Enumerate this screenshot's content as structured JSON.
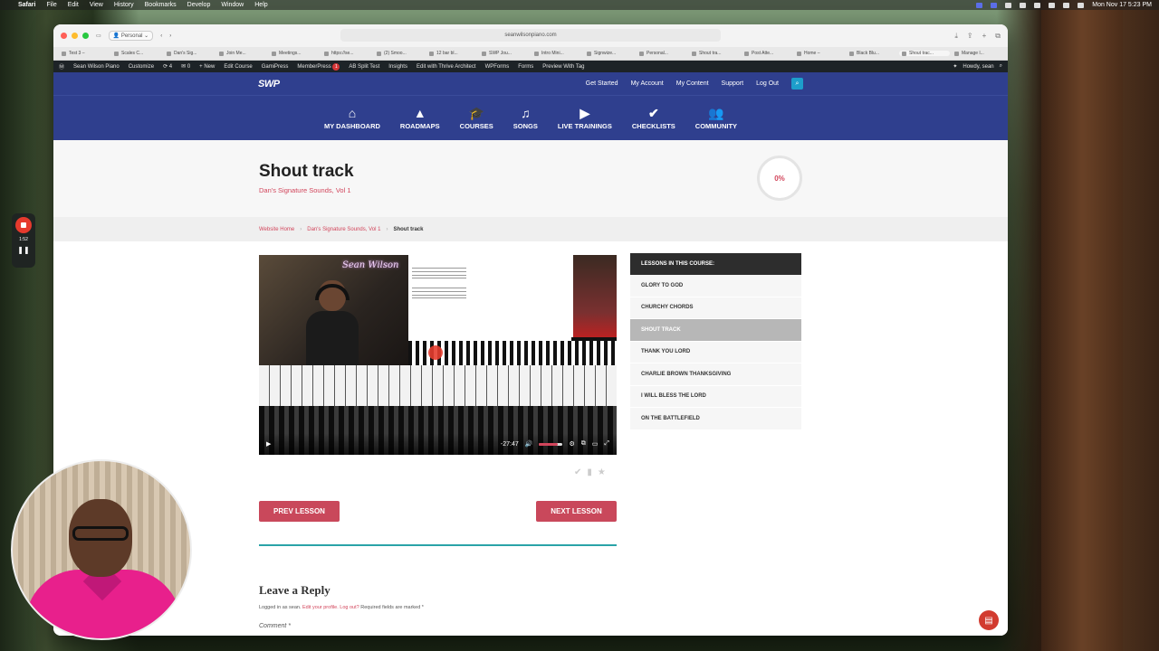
{
  "menubar": {
    "app": "Safari",
    "items": [
      "File",
      "Edit",
      "View",
      "History",
      "Bookmarks",
      "Develop",
      "Window",
      "Help"
    ],
    "clock": "Mon Nov 17  5:23 PM"
  },
  "browser": {
    "profile": "Personal",
    "url": "seanwilsonpiano.com",
    "tabs": [
      "Test 3 –",
      "Scales C...",
      "Dan's Sig...",
      "Join Me...",
      "Meetings...",
      "https://se...",
      "(2) Smoo...",
      "12 bar bl...",
      "SWP Jou...",
      "Intro Mini...",
      "Signwize...",
      "Personal...",
      "Shout tra...",
      "Post Atte...",
      "Home –",
      "Black Blu...",
      "Shout trac...",
      "Manage l..."
    ]
  },
  "adminbar": {
    "site": "Sean Wilson Piano",
    "customize": "Customize",
    "updates": "4",
    "comments": "0",
    "new": "New",
    "edit_course": "Edit Course",
    "gamipress": "GamiPress",
    "memberpress": "MemberPress",
    "memberpress_badge": "1",
    "ab_split": "AB Split Test",
    "insights": "Insights",
    "thrive": "Edit with Thrive Architect",
    "wpforms": "WPForms",
    "forms": "Forms",
    "preview_tag": "Preview With Tag",
    "howdy": "Howdy, sean"
  },
  "site": {
    "logo": "SWP",
    "toplinks": [
      "Get Started",
      "My Account",
      "My Content",
      "Support",
      "Log Out"
    ],
    "nav": [
      {
        "label": "MY DASHBOARD",
        "icon": "home-icon",
        "glyph": "⌂"
      },
      {
        "label": "ROADMAPS",
        "icon": "roadmap-icon",
        "glyph": "▲"
      },
      {
        "label": "COURSES",
        "icon": "graduation-cap-icon",
        "glyph": "🎓"
      },
      {
        "label": "SONGS",
        "icon": "music-note-icon",
        "glyph": "♫"
      },
      {
        "label": "LIVE TRAININGS",
        "icon": "play-icon",
        "glyph": "▶"
      },
      {
        "label": "CHECKLISTS",
        "icon": "checkmark-icon",
        "glyph": "✔"
      },
      {
        "label": "COMMUNITY",
        "icon": "users-icon",
        "glyph": "👥"
      }
    ]
  },
  "page": {
    "title": "Shout track",
    "subtitle": "Dan's Signature Sounds, Vol 1",
    "progress": "0%",
    "breadcrumb": [
      "Website Home",
      "Dan's Signature Sounds, Vol 1",
      "Shout track"
    ]
  },
  "video": {
    "neon_sign": "Sean Wilson",
    "time_remaining": "-27:47",
    "volume_level": 0.8
  },
  "lesson_nav": {
    "prev": "PREV LESSON",
    "next": "NEXT LESSON"
  },
  "sidebar": {
    "header": "LESSONS IN THIS COURSE:",
    "lessons": [
      "GLORY TO GOD",
      "CHURCHY CHORDS",
      "SHOUT TRACK",
      "THANK YOU LORD",
      "CHARLIE BROWN THANKSGIVING",
      "I WILL BLESS THE LORD",
      "ON THE BATTLEFIELD"
    ],
    "active_index": 2
  },
  "comments": {
    "title": "Leave a Reply",
    "logged_in_prefix": "Logged in as sean.",
    "edit_profile": "Edit your profile.",
    "logout": "Log out?",
    "required": "Required fields are marked *",
    "comment_label": "Comment *"
  },
  "recorder": {
    "time": "1:52"
  },
  "colors": {
    "nav_blue": "#2f3f8e",
    "accent_red": "#c9485b",
    "teal": "#2aa3a8"
  }
}
